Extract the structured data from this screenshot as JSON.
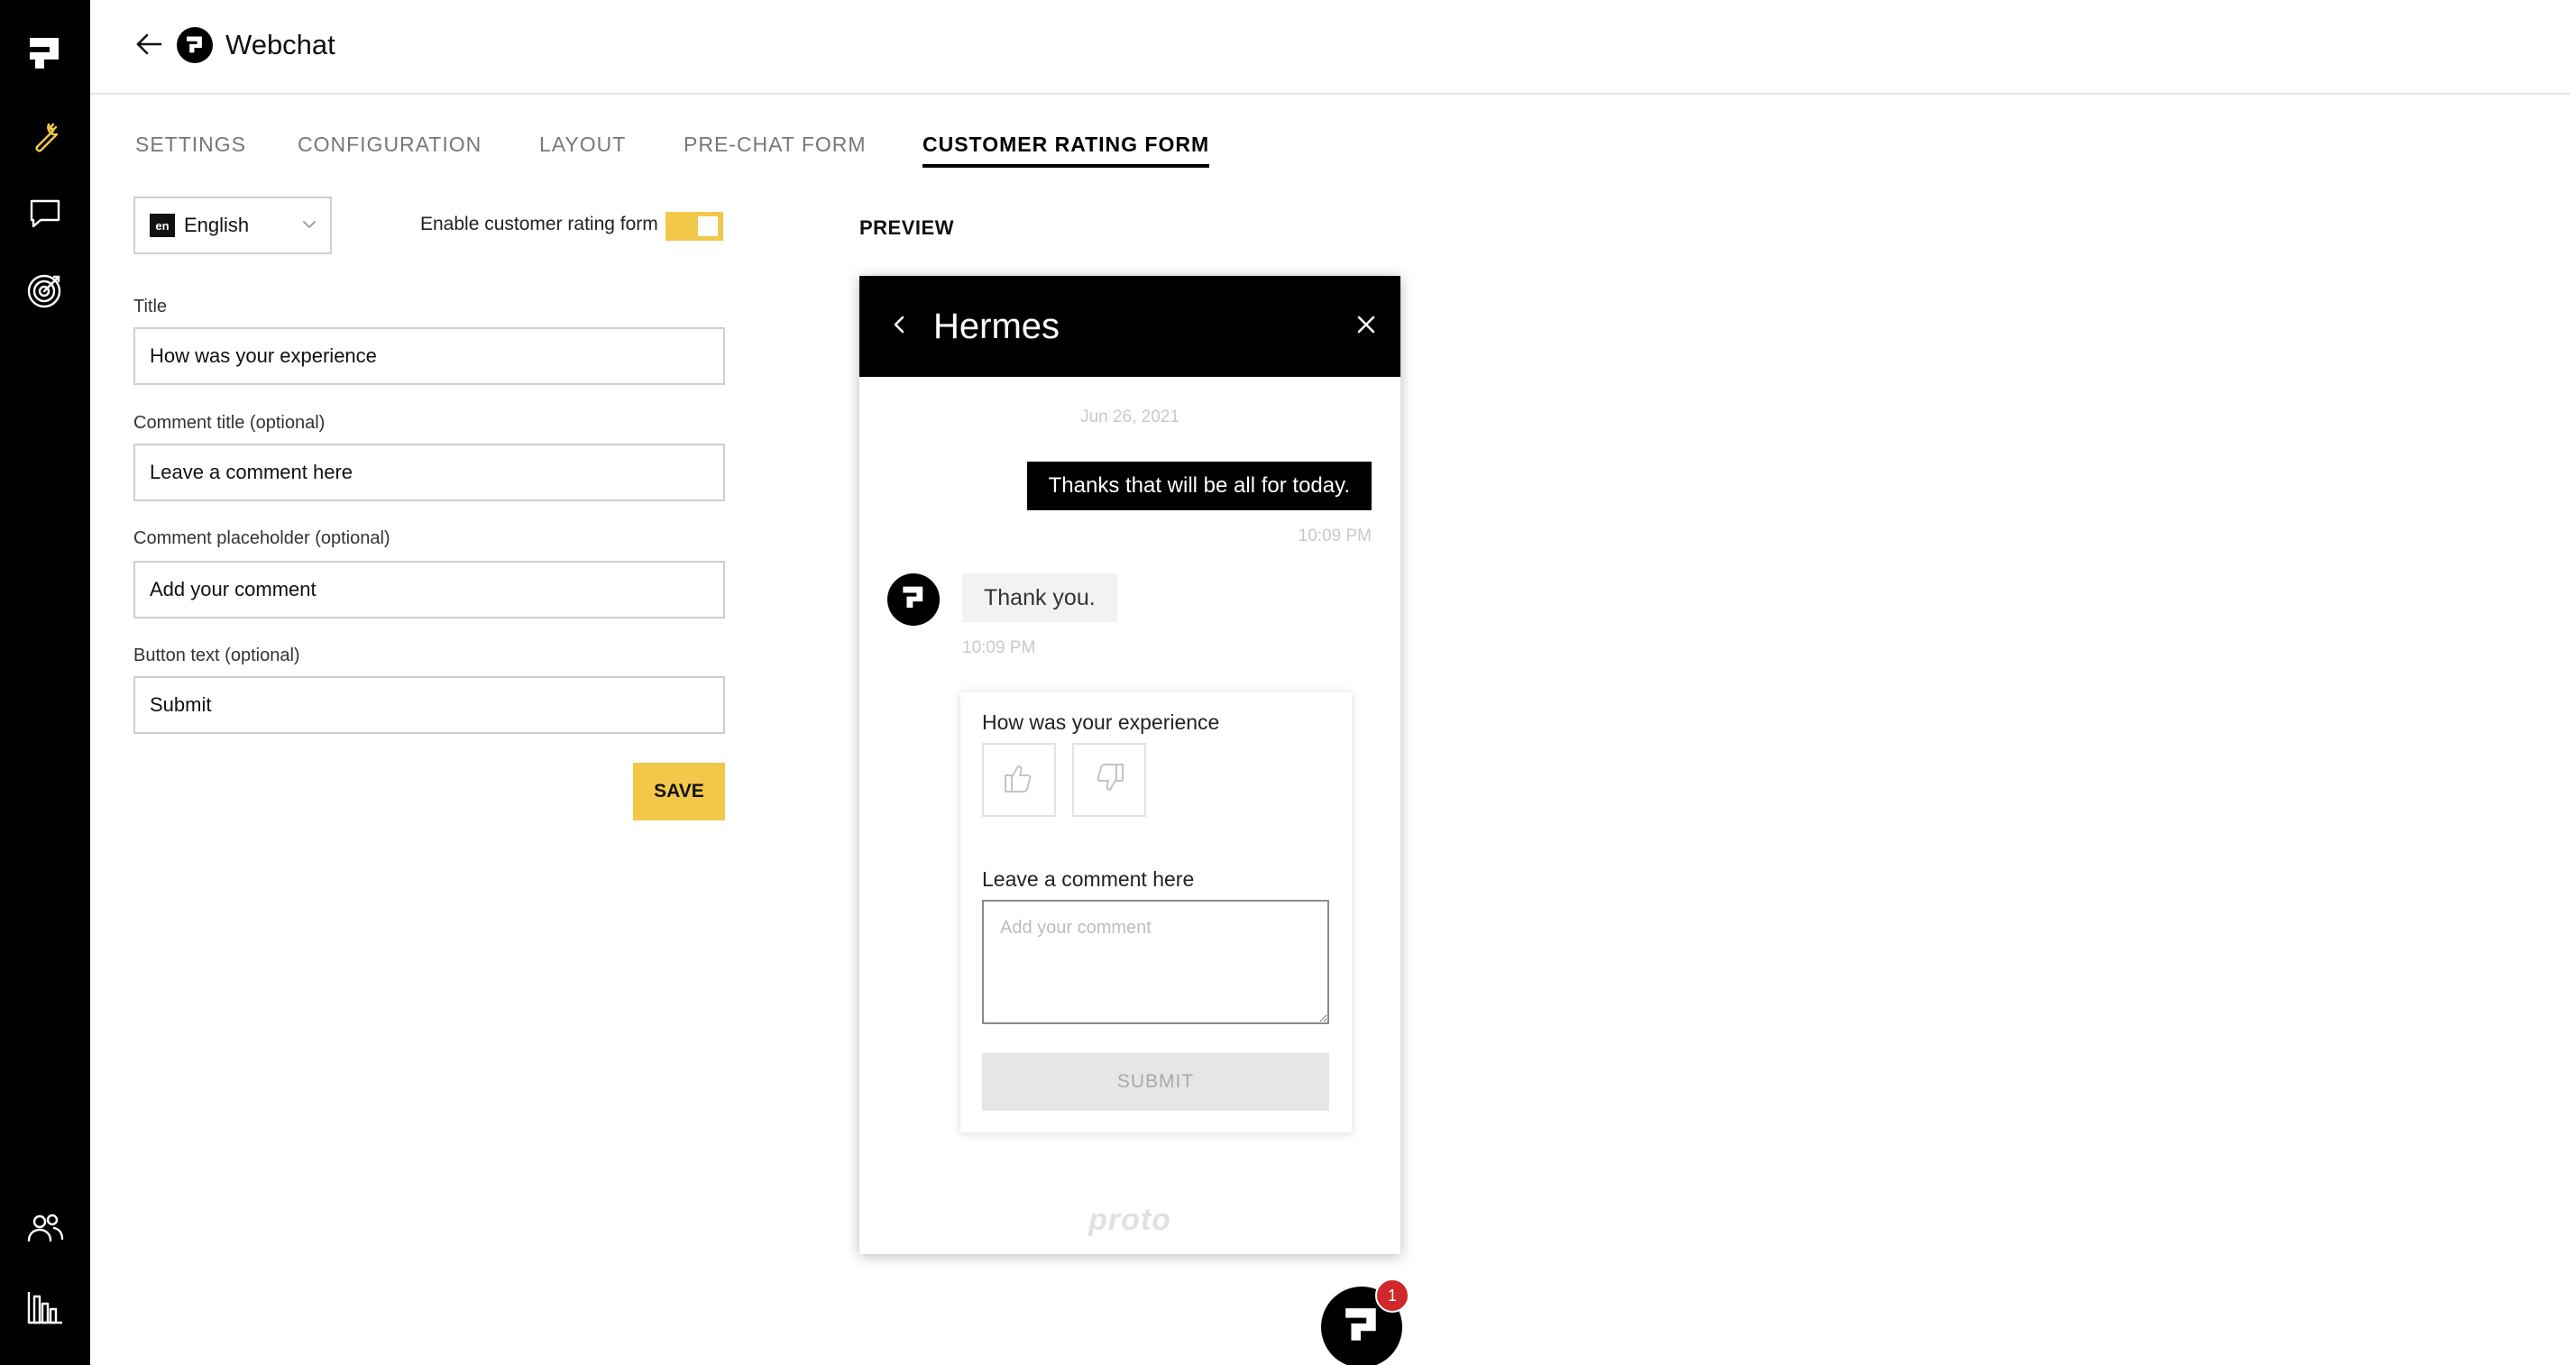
{
  "header": {
    "title": "Webchat"
  },
  "tabs": [
    {
      "label": "SETTINGS",
      "active": false
    },
    {
      "label": "CONFIGURATION",
      "active": false
    },
    {
      "label": "LAYOUT",
      "active": false
    },
    {
      "label": "PRE-CHAT FORM",
      "active": false
    },
    {
      "label": "CUSTOMER RATING FORM",
      "active": true
    }
  ],
  "form": {
    "language": {
      "code": "en",
      "label": "English"
    },
    "enable_rating": {
      "label": "Enable customer rating form",
      "enabled": true
    },
    "title": {
      "label": "Title",
      "value": "How was your experience"
    },
    "comment_title": {
      "label": "Comment title (optional)",
      "value": "Leave a comment here"
    },
    "comment_placeholder": {
      "label": "Comment placeholder (optional)",
      "value": "Add your comment"
    },
    "button_text": {
      "label": "Button text (optional)",
      "value": "Submit"
    },
    "save_label": "SAVE"
  },
  "preview": {
    "label": "PREVIEW",
    "widget": {
      "title": "Hermes",
      "date": "Jun 26, 2021",
      "user_message": "Thanks that will be all for today.",
      "user_time": "10:09 PM",
      "bot_message": "Thank you.",
      "bot_time": "10:09 PM",
      "rating": {
        "title": "How was your experience",
        "comment_title": "Leave a comment here",
        "placeholder": "Add your comment",
        "submit_label": "SUBMIT"
      },
      "footer_brand": "proto"
    },
    "launcher_badge": "1"
  },
  "colors": {
    "rail": "#000000",
    "accent_yellow": "#f2c84b",
    "badge_red": "#d0282b"
  },
  "icons": {
    "rail": [
      "brand-logo-icon",
      "wrench-icon",
      "chat-bubble-icon",
      "target-icon",
      "users-icon",
      "bar-chart-icon"
    ],
    "header": [
      "arrow-left-icon",
      "brand-logo-icon"
    ],
    "widget": [
      "chevron-left-icon",
      "close-icon",
      "thumbs-up-icon",
      "thumbs-down-icon"
    ]
  }
}
